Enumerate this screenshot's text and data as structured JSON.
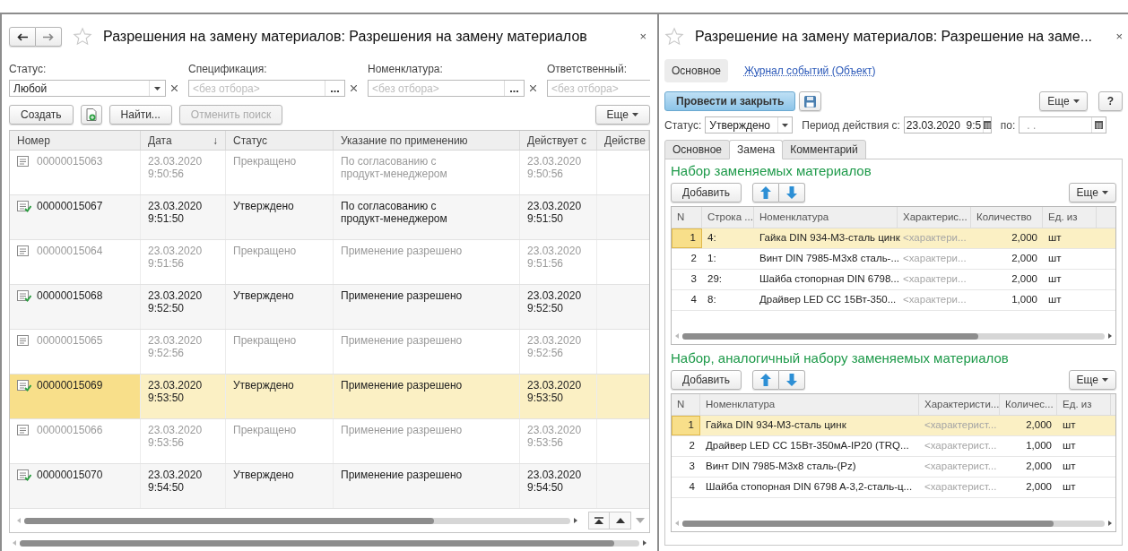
{
  "list_window": {
    "title": "Разрешения на замену материалов: Разрешения на замену материалов",
    "close": "×",
    "filters": [
      {
        "label": "Статус:",
        "value": "Любой",
        "kind": "select"
      },
      {
        "label": "Спецификация:",
        "placeholder": "<без отбора>",
        "kind": "picker"
      },
      {
        "label": "Номенклатура:",
        "placeholder": "<без отбора>",
        "kind": "picker"
      },
      {
        "label": "Ответственный:",
        "placeholder": "<без отбора>",
        "kind": "dropdown"
      }
    ],
    "toolbar": [
      {
        "label": "Создать",
        "disabled": false
      },
      {
        "label": "Найти...",
        "disabled": false
      },
      {
        "label": "Отменить поиск",
        "disabled": true
      }
    ],
    "more": "Еще",
    "columns": [
      {
        "label": "Номер"
      },
      {
        "label": "Дата",
        "sort_mark": "↓"
      },
      {
        "label": "Статус"
      },
      {
        "label": "Указание по применению"
      },
      {
        "label": "Действует с"
      },
      {
        "label": "Действе"
      }
    ],
    "rows": [
      {
        "number": "00000015063",
        "date": [
          "23.03.2020",
          "9:50:56"
        ],
        "status": "Прекращено",
        "usage": [
          "По согласованию с",
          "продукт-менеджером"
        ],
        "valid_from": [
          "23.03.2020",
          "9:50:56"
        ],
        "kind": "stopped",
        "selected": false
      },
      {
        "number": "00000015067",
        "date": [
          "23.03.2020",
          "9:51:50"
        ],
        "status": "Утверждено",
        "usage": [
          "По согласованию с",
          "продукт-менеджером"
        ],
        "valid_from": [
          "23.03.2020",
          "9:51:50"
        ],
        "kind": "approved",
        "selected": false
      },
      {
        "number": "00000015064",
        "date": [
          "23.03.2020",
          "9:51:56"
        ],
        "status": "Прекращено",
        "usage": [
          "Применение разрешено"
        ],
        "valid_from": [
          "23.03.2020",
          "9:51:56"
        ],
        "kind": "stopped",
        "selected": false
      },
      {
        "number": "00000015068",
        "date": [
          "23.03.2020",
          "9:52:50"
        ],
        "status": "Утверждено",
        "usage": [
          "Применение разрешено"
        ],
        "valid_from": [
          "23.03.2020",
          "9:52:50"
        ],
        "kind": "approved",
        "selected": false
      },
      {
        "number": "00000015065",
        "date": [
          "23.03.2020",
          "9:52:56"
        ],
        "status": "Прекращено",
        "usage": [
          "Применение разрешено"
        ],
        "valid_from": [
          "23.03.2020",
          "9:52:56"
        ],
        "kind": "stopped",
        "selected": false
      },
      {
        "number": "00000015069",
        "date": [
          "23.03.2020",
          "9:53:50"
        ],
        "status": "Утверждено",
        "usage": [
          "Применение разрешено"
        ],
        "valid_from": [
          "23.03.2020",
          "9:53:50"
        ],
        "kind": "approved",
        "selected": true
      },
      {
        "number": "00000015066",
        "date": [
          "23.03.2020",
          "9:53:56"
        ],
        "status": "Прекращено",
        "usage": [
          "Применение разрешено"
        ],
        "valid_from": [
          "23.03.2020",
          "9:53:56"
        ],
        "kind": "stopped",
        "selected": false
      },
      {
        "number": "00000015070",
        "date": [
          "23.03.2020",
          "9:54:50"
        ],
        "status": "Утверждено",
        "usage": [
          "Применение разрешено"
        ],
        "valid_from": [
          "23.03.2020",
          "9:54:50"
        ],
        "kind": "approved",
        "selected": false
      }
    ]
  },
  "form_window": {
    "title": "Разрешение на замену материалов: Разрешение на заме...",
    "close": "×",
    "nav": [
      {
        "label": "Основное",
        "selected": true
      },
      {
        "label": "Журнал событий (Объект)",
        "selected": false
      }
    ],
    "post_button": "Провести и закрыть",
    "more": "Еще",
    "help": "?",
    "status_label": "Статус:",
    "status_value": "Утверждено",
    "period_label": "Период действия с:",
    "period_from": "23.03.2020  9:5",
    "period_to_label": "по:",
    "period_to": ". .",
    "tabs": [
      {
        "label": "Основное",
        "selected": false
      },
      {
        "label": "Замена",
        "selected": true
      },
      {
        "label": "Комментарий",
        "selected": false
      }
    ],
    "replaced_set": {
      "title": "Набор заменяемых материалов",
      "add": "Добавить",
      "more": "Еще",
      "columns": [
        "N",
        "Строка ...",
        "Номенклатура",
        "Характерис...",
        "Количество",
        "Ед. из"
      ],
      "rows": [
        {
          "n": "1",
          "line": "4:",
          "item": "Гайка DIN 934-М3-сталь цинк",
          "characteristic": "<характери...",
          "quantity": "2,000",
          "unit": "шт",
          "selected": true
        },
        {
          "n": "2",
          "line": "1:",
          "item": "Винт DIN 7985-М3х8 сталь-...",
          "characteristic": "<характери...",
          "quantity": "2,000",
          "unit": "шт",
          "selected": false
        },
        {
          "n": "3",
          "line": "29:",
          "item": "Шайба стопорная DIN 6798...",
          "characteristic": "<характери...",
          "quantity": "2,000",
          "unit": "шт",
          "selected": false
        },
        {
          "n": "4",
          "line": "8:",
          "item": "Драйвер LED CC 15Вт-350...",
          "characteristic": "<характери...",
          "quantity": "1,000",
          "unit": "шт",
          "selected": false
        }
      ]
    },
    "analog_set": {
      "title": "Набор, аналогичный набору заменяемых материалов",
      "add": "Добавить",
      "more": "Еще",
      "columns": [
        "N",
        "Номенклатура",
        "Характеристи...",
        "Количес...",
        "Ед. из"
      ],
      "rows": [
        {
          "n": "1",
          "item": "Гайка DIN 934-М3-сталь цинк",
          "characteristic": "<характерист...",
          "quantity": "2,000",
          "unit": "шт",
          "selected": true
        },
        {
          "n": "2",
          "item": "Драйвер LED CC 15Вт-350мА-IP20 (TRQ...",
          "characteristic": "<характерист...",
          "quantity": "1,000",
          "unit": "шт",
          "selected": false
        },
        {
          "n": "3",
          "item": "Винт DIN 7985-М3х8 сталь-(Pz)",
          "characteristic": "<характерист...",
          "quantity": "2,000",
          "unit": "шт",
          "selected": false
        },
        {
          "n": "4",
          "item": "Шайба стопорная DIN 6798 A-3,2-сталь-ц...",
          "characteristic": "<характерист...",
          "quantity": "2,000",
          "unit": "шт",
          "selected": false
        }
      ]
    }
  }
}
